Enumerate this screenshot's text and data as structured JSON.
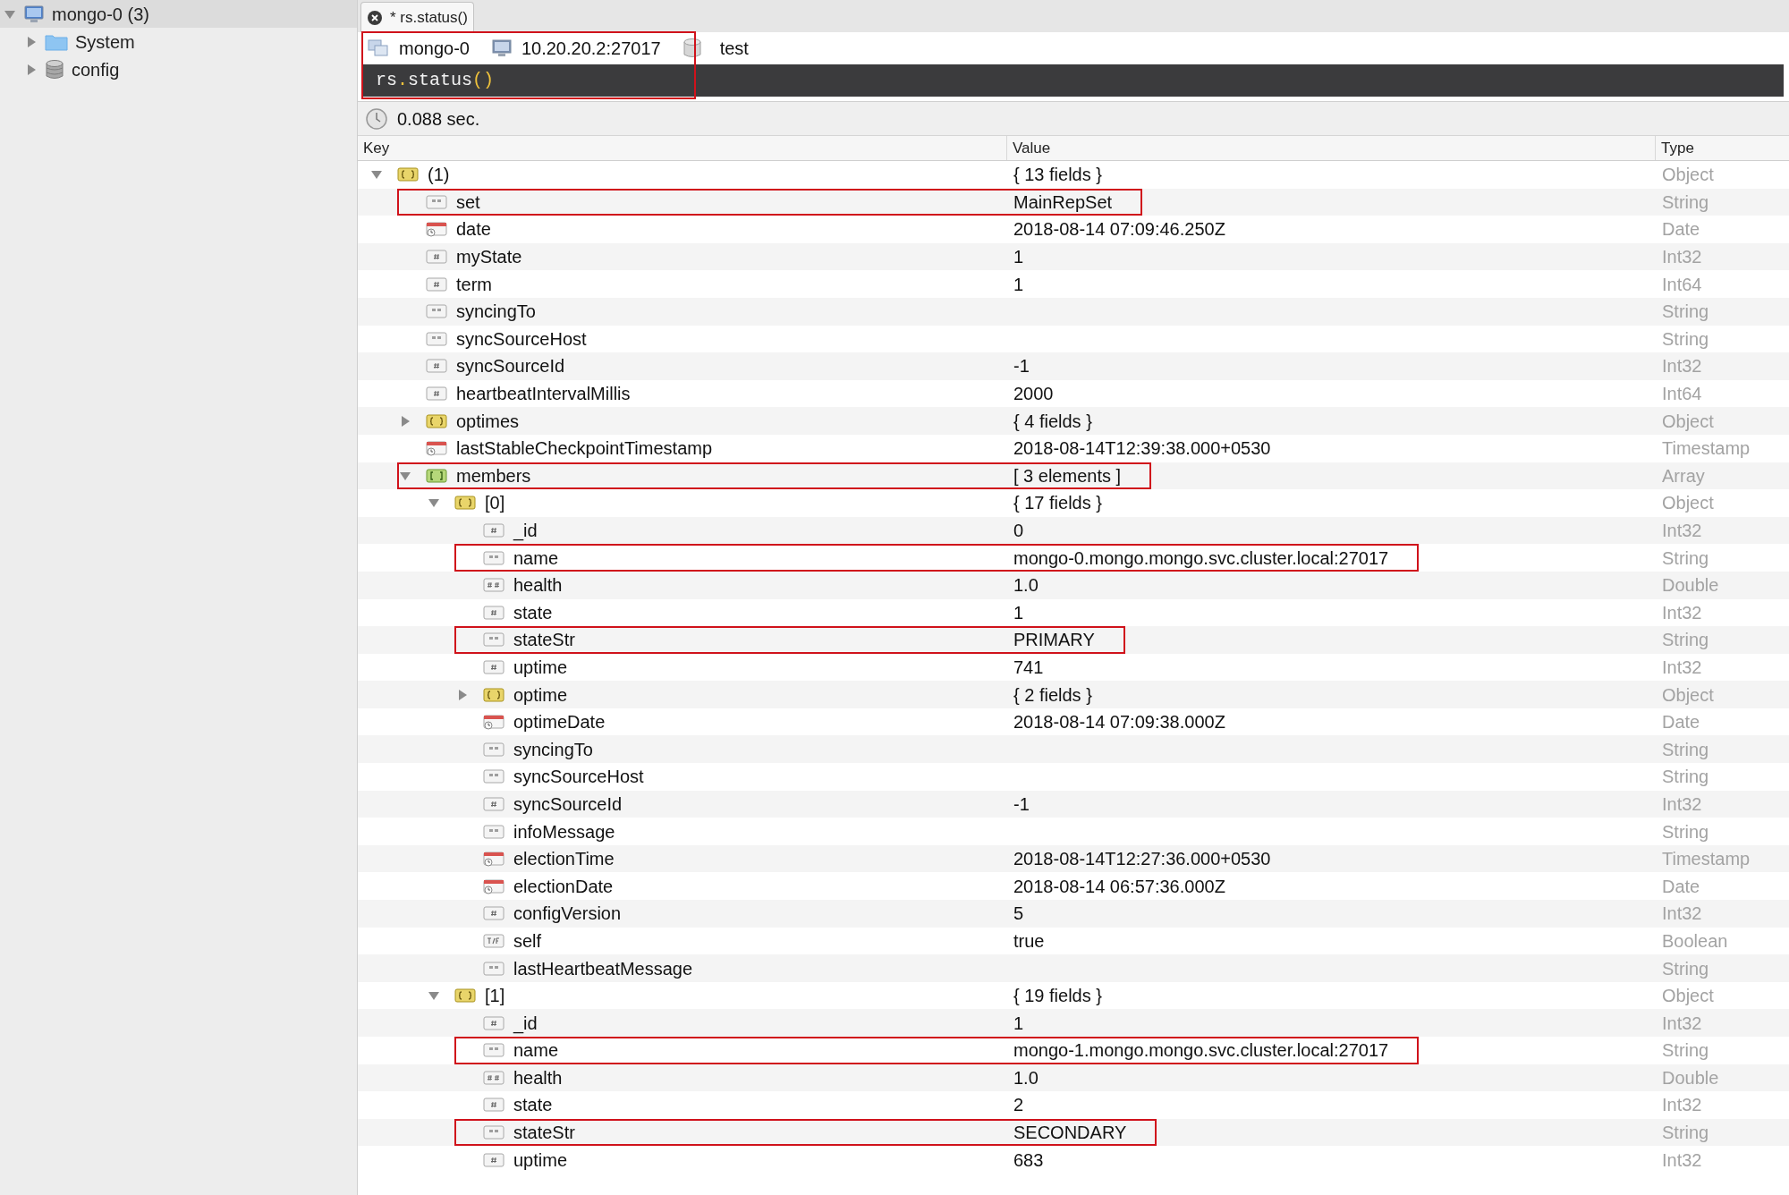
{
  "sidebar": {
    "items": [
      {
        "label": "mongo-0 (3)",
        "kind": "server",
        "expanded": true,
        "selected": true,
        "children": [
          {
            "label": "System",
            "kind": "folder",
            "expanded": false,
            "selected": false
          },
          {
            "label": "config",
            "kind": "database",
            "expanded": false,
            "selected": false
          }
        ]
      }
    ]
  },
  "tabs": [
    {
      "label": "* rs.status()",
      "selected": true
    }
  ],
  "query_bar": {
    "annotated": true,
    "connection": "mongo-0",
    "server": "10.20.20.2:27017",
    "database": "test",
    "code": [
      {
        "text": "rs",
        "kind": "identifier"
      },
      {
        "text": ".",
        "kind": "punctuation"
      },
      {
        "text": "status",
        "kind": "identifier"
      },
      {
        "text": "()",
        "kind": "punctuation"
      }
    ]
  },
  "elapsed": "0.088 sec.",
  "table": {
    "columns": [
      "Key",
      "Value",
      "Type"
    ]
  },
  "tree": [
    {
      "key": "(1)",
      "value": "{ 13 fields }",
      "type": "Object",
      "kind": "object",
      "expanded": true,
      "annotated": false,
      "children": [
        {
          "key": "set",
          "value": "MainRepSet",
          "type": "String",
          "kind": "string",
          "annotated": true
        },
        {
          "key": "date",
          "value": "2018-08-14 07:09:46.250Z",
          "type": "Date",
          "kind": "date",
          "annotated": false
        },
        {
          "key": "myState",
          "value": "1",
          "type": "Int32",
          "kind": "int",
          "annotated": false
        },
        {
          "key": "term",
          "value": "1",
          "type": "Int64",
          "kind": "int",
          "annotated": false
        },
        {
          "key": "syncingTo",
          "type": "String",
          "kind": "string",
          "annotated": false
        },
        {
          "key": "syncSourceHost",
          "type": "String",
          "kind": "string",
          "annotated": false
        },
        {
          "key": "syncSourceId",
          "value": "-1",
          "type": "Int32",
          "kind": "int",
          "annotated": false
        },
        {
          "key": "heartbeatIntervalMillis",
          "value": "2000",
          "type": "Int64",
          "kind": "int",
          "annotated": false
        },
        {
          "key": "optimes",
          "value": "{ 4 fields }",
          "type": "Object",
          "kind": "object",
          "expanded": false,
          "annotated": false
        },
        {
          "key": "lastStableCheckpointTimestamp",
          "value": "2018-08-14T12:39:38.000+0530",
          "type": "Timestamp",
          "kind": "date",
          "annotated": false
        },
        {
          "key": "members",
          "value": "[ 3 elements ]",
          "type": "Array",
          "kind": "array",
          "expanded": true,
          "annotated": true,
          "children": [
            {
              "key": "[0]",
              "value": "{ 17 fields }",
              "type": "Object",
              "kind": "object",
              "expanded": true,
              "annotated": false,
              "children": [
                {
                  "key": "_id",
                  "value": "0",
                  "type": "Int32",
                  "kind": "int",
                  "annotated": false
                },
                {
                  "key": "name",
                  "value": "mongo-0.mongo.mongo.svc.cluster.local:27017",
                  "type": "String",
                  "kind": "string",
                  "annotated": true
                },
                {
                  "key": "health",
                  "value": "1.0",
                  "type": "Double",
                  "kind": "double",
                  "annotated": false
                },
                {
                  "key": "state",
                  "value": "1",
                  "type": "Int32",
                  "kind": "int",
                  "annotated": false
                },
                {
                  "key": "stateStr",
                  "value": "PRIMARY",
                  "type": "String",
                  "kind": "string",
                  "annotated": true
                },
                {
                  "key": "uptime",
                  "value": "741",
                  "type": "Int32",
                  "kind": "int",
                  "annotated": false
                },
                {
                  "key": "optime",
                  "value": "{ 2 fields }",
                  "type": "Object",
                  "kind": "object",
                  "expanded": false,
                  "annotated": false
                },
                {
                  "key": "optimeDate",
                  "value": "2018-08-14 07:09:38.000Z",
                  "type": "Date",
                  "kind": "date",
                  "annotated": false
                },
                {
                  "key": "syncingTo",
                  "type": "String",
                  "kind": "string",
                  "annotated": false
                },
                {
                  "key": "syncSourceHost",
                  "type": "String",
                  "kind": "string",
                  "annotated": false
                },
                {
                  "key": "syncSourceId",
                  "value": "-1",
                  "type": "Int32",
                  "kind": "int",
                  "annotated": false
                },
                {
                  "key": "infoMessage",
                  "type": "String",
                  "kind": "string",
                  "annotated": false
                },
                {
                  "key": "electionTime",
                  "value": "2018-08-14T12:27:36.000+0530",
                  "type": "Timestamp",
                  "kind": "date",
                  "annotated": false
                },
                {
                  "key": "electionDate",
                  "value": "2018-08-14 06:57:36.000Z",
                  "type": "Date",
                  "kind": "date",
                  "annotated": false
                },
                {
                  "key": "configVersion",
                  "value": "5",
                  "type": "Int32",
                  "kind": "int",
                  "annotated": false
                },
                {
                  "key": "self",
                  "value": "true",
                  "type": "Boolean",
                  "kind": "bool",
                  "annotated": false
                },
                {
                  "key": "lastHeartbeatMessage",
                  "type": "String",
                  "kind": "string",
                  "annotated": false
                }
              ]
            },
            {
              "key": "[1]",
              "value": "{ 19 fields }",
              "type": "Object",
              "kind": "object",
              "expanded": true,
              "annotated": false,
              "children": [
                {
                  "key": "_id",
                  "value": "1",
                  "type": "Int32",
                  "kind": "int",
                  "annotated": false
                },
                {
                  "key": "name",
                  "value": "mongo-1.mongo.mongo.svc.cluster.local:27017",
                  "type": "String",
                  "kind": "string",
                  "annotated": true
                },
                {
                  "key": "health",
                  "value": "1.0",
                  "type": "Double",
                  "kind": "double",
                  "annotated": false
                },
                {
                  "key": "state",
                  "value": "2",
                  "type": "Int32",
                  "kind": "int",
                  "annotated": false
                },
                {
                  "key": "stateStr",
                  "value": "SECONDARY",
                  "type": "String",
                  "kind": "string",
                  "annotated": true
                },
                {
                  "key": "uptime",
                  "value": "683",
                  "type": "Int32",
                  "kind": "int",
                  "annotated": false
                }
              ]
            }
          ]
        }
      ]
    }
  ]
}
